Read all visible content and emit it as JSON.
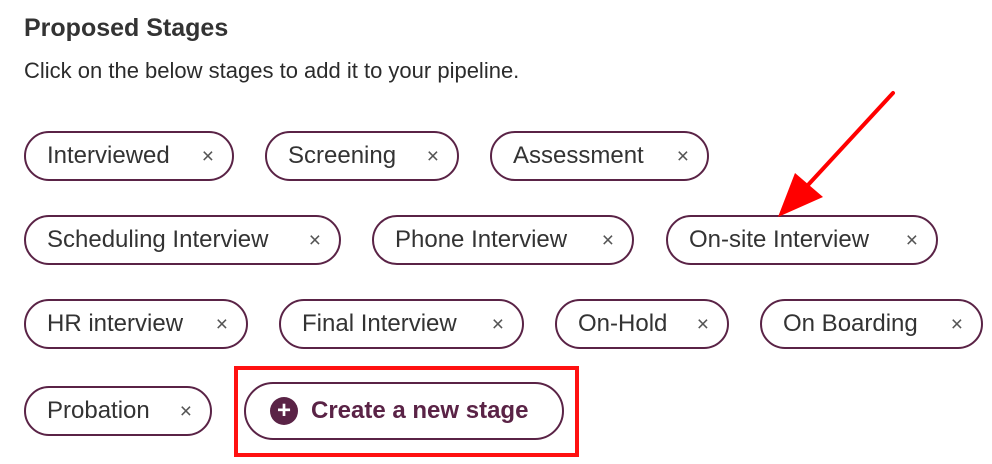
{
  "header": {
    "title": "Proposed Stages",
    "subtitle": "Click on the below stages to add it to your pipeline."
  },
  "stages": [
    {
      "label": "Interviewed",
      "remove_icon": "×"
    },
    {
      "label": "Screening",
      "remove_icon": "×"
    },
    {
      "label": "Assessment",
      "remove_icon": "×"
    },
    {
      "label": "Scheduling Interview",
      "remove_icon": "×"
    },
    {
      "label": "Phone Interview",
      "remove_icon": "×"
    },
    {
      "label": "On-site Interview",
      "remove_icon": "×"
    },
    {
      "label": "HR interview",
      "remove_icon": "×"
    },
    {
      "label": "Final Interview",
      "remove_icon": "×"
    },
    {
      "label": "On-Hold",
      "remove_icon": "×"
    },
    {
      "label": "On Boarding",
      "remove_icon": "×"
    },
    {
      "label": "Probation",
      "remove_icon": "×"
    }
  ],
  "create_button": {
    "icon": "+",
    "label": "Create a new stage"
  },
  "annotations": {
    "arrow_color": "#ff0000",
    "highlight_color": "#ff1111"
  },
  "colors": {
    "accent": "#5a2346",
    "text": "#333333"
  }
}
